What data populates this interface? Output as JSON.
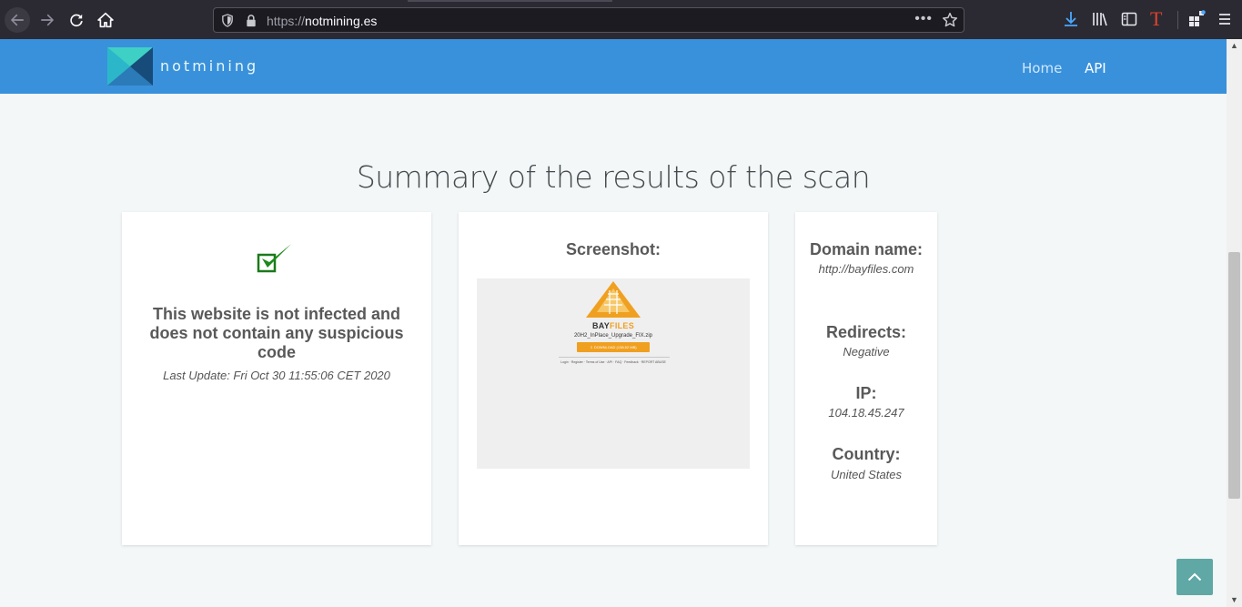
{
  "browser": {
    "url_protocol": "https://",
    "url_host": "notmining.es",
    "menu_dots": "•••"
  },
  "site": {
    "brand": "notmining",
    "nav": {
      "home": "Home",
      "api": "API"
    }
  },
  "page": {
    "title": "Summary of the results of the scan"
  },
  "status_card": {
    "message": "This website is not infected and does not contain any suspicious code",
    "last_update": "Last Update: Fri Oct 30 11:55:06 CET 2020"
  },
  "screenshot_card": {
    "title": "Screenshot:",
    "preview": {
      "brand_bay": "BAY",
      "brand_files": "FILES",
      "filename": "20H2_InPlace_Upgrade_FIX.zip",
      "download_label": "⇩ DOWNLOAD (138.52 MB)",
      "footer_links": "Login · Register · Terms of Use · API · FAQ · Feedback · REPORT ABUSE"
    }
  },
  "info_card": {
    "domain_label": "Domain name:",
    "domain_value": "http://bayfiles.com",
    "redirects_label": "Redirects:",
    "redirects_value": "Negative",
    "ip_label": "IP:",
    "ip_value": "104.18.45.247",
    "country_label": "Country:",
    "country_value": "United States"
  },
  "colors": {
    "header_blue": "#3991dc",
    "check_green": "#1a8a1a",
    "to_top_teal": "#5fa8a5",
    "bayfiles_orange": "#f0a020"
  },
  "icons": [
    "back-arrow-icon",
    "forward-arrow-icon",
    "reload-icon",
    "home-icon",
    "shield-icon",
    "lock-icon",
    "star-icon",
    "download-icon",
    "library-icon",
    "sidebar-icon",
    "extension-t-icon",
    "extensions-icon",
    "hamburger-menu-icon",
    "checkmark-icon",
    "chevron-up-icon"
  ]
}
